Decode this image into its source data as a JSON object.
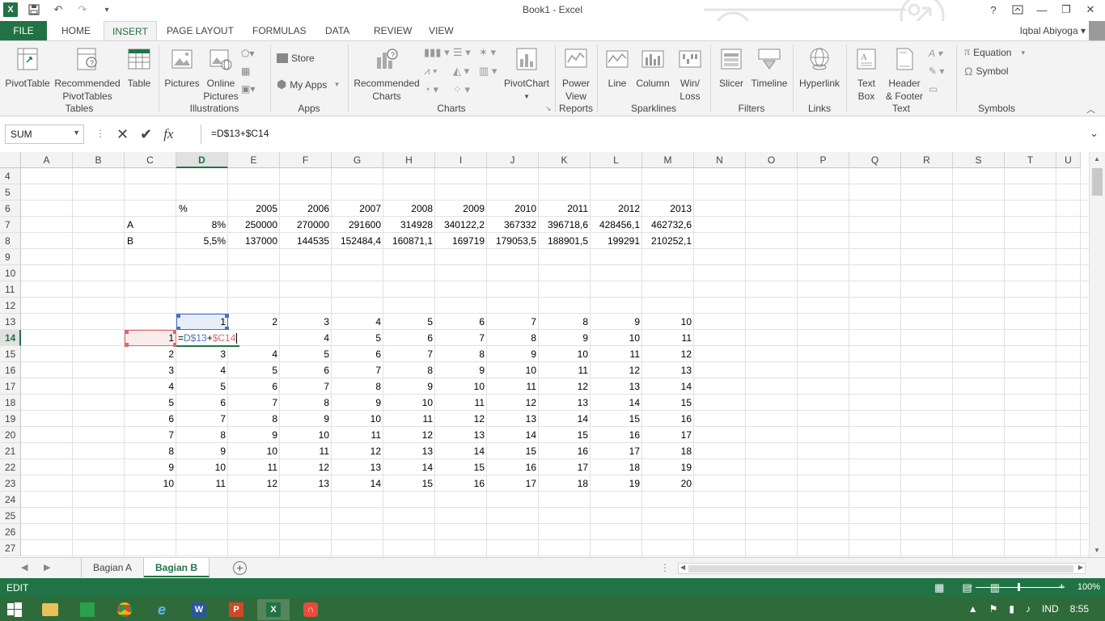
{
  "app": {
    "title": "Book1 - Excel",
    "logo_letter": "X",
    "user": "Iqbal Abiyoga",
    "help": "?"
  },
  "tabs": [
    "FILE",
    "HOME",
    "INSERT",
    "PAGE LAYOUT",
    "FORMULAS",
    "DATA",
    "REVIEW",
    "VIEW"
  ],
  "active_tab": "INSERT",
  "ribbon": {
    "groups": {
      "tables": "Tables",
      "illustrations": "Illustrations",
      "apps": "Apps",
      "charts": "Charts",
      "reports": "Reports",
      "sparklines": "Sparklines",
      "filters": "Filters",
      "links": "Links",
      "text": "Text",
      "symbols": "Symbols"
    },
    "buttons": {
      "pivottable": "PivotTable",
      "recommended_pivottables_1": "Recommended",
      "recommended_pivottables_2": "PivotTables",
      "table": "Table",
      "pictures": "Pictures",
      "online_pictures_1": "Online",
      "online_pictures_2": "Pictures",
      "store": "Store",
      "my_apps": "My Apps",
      "recommended_charts_1": "Recommended",
      "recommended_charts_2": "Charts",
      "pivotchart": "PivotChart",
      "power_view_1": "Power",
      "power_view_2": "View",
      "line": "Line",
      "column": "Column",
      "winloss_1": "Win/",
      "winloss_2": "Loss",
      "slicer": "Slicer",
      "timeline": "Timeline",
      "hyperlink": "Hyperlink",
      "textbox_1": "Text",
      "textbox_2": "Box",
      "header_footer_1": "Header",
      "header_footer_2": "& Footer",
      "equation": "Equation",
      "symbol": "Symbol"
    }
  },
  "formula_bar": {
    "name_box": "SUM",
    "formula": "=D$13+$C14"
  },
  "grid": {
    "columns": [
      "A",
      "B",
      "C",
      "D",
      "E",
      "F",
      "G",
      "H",
      "I",
      "J",
      "K",
      "L",
      "M",
      "N",
      "O",
      "P",
      "Q",
      "R",
      "S",
      "T",
      "U"
    ],
    "selected_column": "D",
    "rows": [
      "4",
      "5",
      "6",
      "7",
      "8",
      "9",
      "10",
      "11",
      "12",
      "13",
      "14",
      "15",
      "16",
      "17",
      "18",
      "19",
      "20",
      "21",
      "22",
      "23",
      "24",
      "25",
      "26",
      "27"
    ],
    "selected_row": "14",
    "row6": [
      "%",
      "2005",
      "2006",
      "2007",
      "2008",
      "2009",
      "2010",
      "2011",
      "2012",
      "2013"
    ],
    "row7": [
      "A",
      "8%",
      "250000",
      "270000",
      "291600",
      "314928",
      "340122,2",
      "367332",
      "396718,6",
      "428456,1",
      "462732,6"
    ],
    "row8": [
      "B",
      "5,5%",
      "137000",
      "144535",
      "152484,4",
      "160871,1",
      "169719",
      "179053,5",
      "188901,5",
      "199291",
      "210252,1"
    ],
    "row13": [
      "1",
      "2",
      "3",
      "4",
      "5",
      "6",
      "7",
      "8",
      "9",
      "10"
    ],
    "row14": [
      "1",
      "",
      "",
      "4",
      "5",
      "6",
      "7",
      "8",
      "9",
      "10",
      "11"
    ],
    "rows15_23": [
      [
        "2",
        "3",
        "4",
        "5",
        "6",
        "7",
        "8",
        "9",
        "10",
        "11",
        "12"
      ],
      [
        "3",
        "4",
        "5",
        "6",
        "7",
        "8",
        "9",
        "10",
        "11",
        "12",
        "13"
      ],
      [
        "4",
        "5",
        "6",
        "7",
        "8",
        "9",
        "10",
        "11",
        "12",
        "13",
        "14"
      ],
      [
        "5",
        "6",
        "7",
        "8",
        "9",
        "10",
        "11",
        "12",
        "13",
        "14",
        "15"
      ],
      [
        "6",
        "7",
        "8",
        "9",
        "10",
        "11",
        "12",
        "13",
        "14",
        "15",
        "16"
      ],
      [
        "7",
        "8",
        "9",
        "10",
        "11",
        "12",
        "13",
        "14",
        "15",
        "16",
        "17"
      ],
      [
        "8",
        "9",
        "10",
        "11",
        "12",
        "13",
        "14",
        "15",
        "16",
        "17",
        "18"
      ],
      [
        "9",
        "10",
        "11",
        "12",
        "13",
        "14",
        "15",
        "16",
        "17",
        "18",
        "19"
      ],
      [
        "10",
        "11",
        "12",
        "13",
        "14",
        "15",
        "16",
        "17",
        "18",
        "19",
        "20"
      ]
    ],
    "editing": {
      "prefix": "=",
      "ref1": "D$13",
      "plus": "+",
      "ref2": "$C14"
    }
  },
  "sheets": [
    "Bagian A",
    "Bagian B"
  ],
  "active_sheet": "Bagian B",
  "status": {
    "mode": "EDIT",
    "zoom": "100%"
  },
  "taskbar": {
    "tray_lang": "IND",
    "time": "8:55"
  },
  "colors": {
    "excel_green": "#217346",
    "ref_blue": "#4472c4",
    "ref_red": "#e06666"
  }
}
